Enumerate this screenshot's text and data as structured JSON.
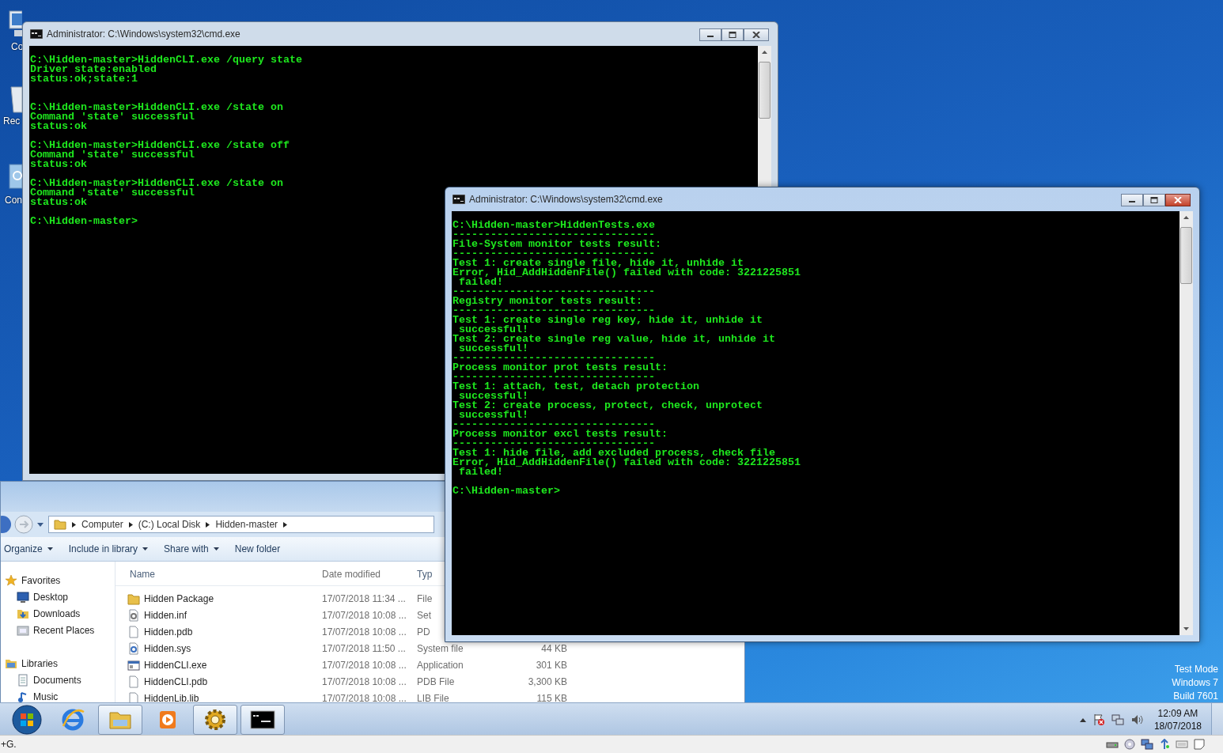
{
  "desktop": {
    "icons": [
      {
        "label": "Co",
        "kind": "computer"
      },
      {
        "label": "Rec",
        "kind": "bin"
      },
      {
        "label": "Con",
        "kind": "panel"
      }
    ],
    "watermark": [
      "Test Mode",
      "Windows 7",
      "Build 7601"
    ]
  },
  "explorer": {
    "breadcrumb": [
      "Computer",
      "(C:) Local Disk",
      "Hidden-master"
    ],
    "toolbar": [
      {
        "label": "Organize",
        "dropdown": true
      },
      {
        "label": "Include in library",
        "dropdown": true
      },
      {
        "label": "Share with",
        "dropdown": true
      },
      {
        "label": "New folder",
        "dropdown": false
      }
    ],
    "nav": [
      {
        "label": "Favorites",
        "kind": "star"
      },
      {
        "label": "Desktop",
        "kind": "desktop"
      },
      {
        "label": "Downloads",
        "kind": "downloads"
      },
      {
        "label": "Recent Places",
        "kind": "recent"
      },
      {
        "label": "Libraries",
        "kind": "library"
      },
      {
        "label": "Documents",
        "kind": "documents"
      },
      {
        "label": "Music",
        "kind": "music"
      }
    ],
    "columns": [
      "Name",
      "Date modified",
      "Typ"
    ],
    "rows": [
      {
        "name": "Hidden Package",
        "date": "17/07/2018 11:34 ...",
        "type": "File",
        "kind": "folder"
      },
      {
        "name": "Hidden.inf",
        "date": "17/07/2018 10:08 ...",
        "type": "Set",
        "kind": "settings"
      },
      {
        "name": "Hidden.pdb",
        "date": "17/07/2018 10:08 ...",
        "type": "PD",
        "kind": "document"
      },
      {
        "name": "Hidden.sys",
        "date": "17/07/2018 11:50 ...",
        "type": "System file",
        "size": "44 KB",
        "kind": "system"
      },
      {
        "name": "HiddenCLI.exe",
        "date": "17/07/2018 10:08 ...",
        "type": "Application",
        "size": "301 KB",
        "kind": "application"
      },
      {
        "name": "HiddenCLI.pdb",
        "date": "17/07/2018 10:08 ...",
        "type": "PDB File",
        "size": "3,300 KB",
        "kind": "document"
      },
      {
        "name": "HiddenLib.lib",
        "date": "17/07/2018 10:08 ...",
        "type": "LIB File",
        "size": "115 KB",
        "kind": "document"
      }
    ]
  },
  "windows": [
    {
      "title": "Administrator: C:\\Windows\\system32\\cmd.exe",
      "active": false,
      "output": "C:\\Hidden-master>HiddenCLI.exe /query state\nDriver state:enabled\nstatus:ok;state:1\n\n\nC:\\Hidden-master>HiddenCLI.exe /state on\nCommand 'state' successful\nstatus:ok\n\nC:\\Hidden-master>HiddenCLI.exe /state off\nCommand 'state' successful\nstatus:ok\n\nC:\\Hidden-master>HiddenCLI.exe /state on\nCommand 'state' successful\nstatus:ok\n\nC:\\Hidden-master>"
    },
    {
      "title": "Administrator: C:\\Windows\\system32\\cmd.exe",
      "active": true,
      "output": "C:\\Hidden-master>HiddenTests.exe\n--------------------------------\nFile-System monitor tests result:\n--------------------------------\nTest 1: create single file, hide it, unhide it\nError, Hid_AddHiddenFile() failed with code: 3221225851\n failed!\n--------------------------------\nRegistry monitor tests result:\n--------------------------------\nTest 1: create single reg key, hide it, unhide it\n successful!\nTest 2: create single reg value, hide it, unhide it\n successful!\n--------------------------------\nProcess monitor prot tests result:\n--------------------------------\nTest 1: attach, test, detach protection\n successful!\nTest 2: create process, protect, check, unprotect\n successful!\n--------------------------------\nProcess monitor excl tests result:\n--------------------------------\nTest 1: hide file, add excluded process, check file\nError, Hid_AddHiddenFile() failed with code: 3221225851\n failed!\n\nC:\\Hidden-master>"
    }
  ],
  "taskbar": {
    "apps": [
      {
        "kind": "browser",
        "open": false
      },
      {
        "kind": "folder",
        "open": true
      },
      {
        "kind": "media",
        "open": false
      },
      {
        "kind": "gear",
        "open": true
      },
      {
        "kind": "console",
        "open": true
      }
    ],
    "time": "12:09 AM",
    "date": "18/07/2018"
  },
  "status_bar": {
    "text": "+G."
  }
}
